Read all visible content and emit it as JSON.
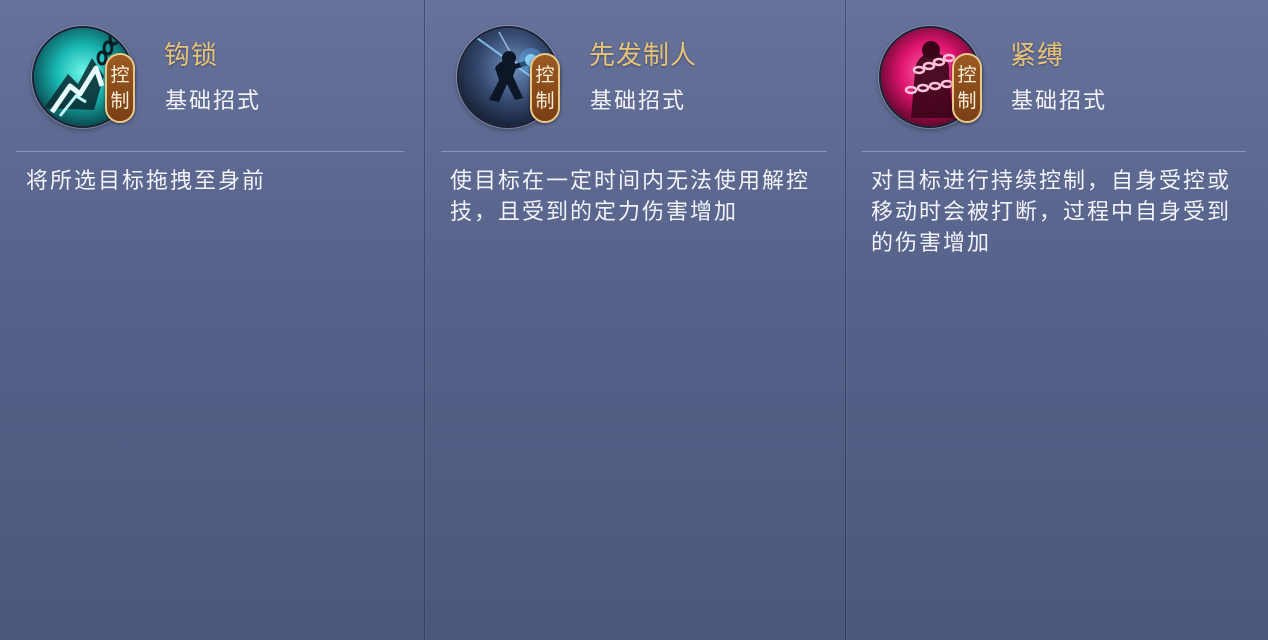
{
  "skills": [
    {
      "name": "钩锁",
      "type": "基础招式",
      "badge": [
        "控",
        "制"
      ],
      "description": "将所选目标拖拽至身前",
      "icon": "hook-chain-icon",
      "accent": "#1fd6c8"
    },
    {
      "name": "先发制人",
      "type": "基础招式",
      "badge": [
        "控",
        "制"
      ],
      "description": "使目标在一定时间内无法使用解控技，且受到的定力伤害增加",
      "icon": "swordsman-strike-icon",
      "accent": "#5aa8ff"
    },
    {
      "name": "紧缚",
      "type": "基础招式",
      "badge": [
        "控",
        "制"
      ],
      "description": "对目标进行持续控制，自身受控或移动时会被打断，过程中自身受到的伤害增加",
      "icon": "bound-chains-icon",
      "accent": "#ff2f8e"
    }
  ],
  "colors": {
    "title": "#e6c27a",
    "badge_fill": "#8a4a1a",
    "badge_border": "#e9c98a",
    "panel": "#56628a"
  }
}
